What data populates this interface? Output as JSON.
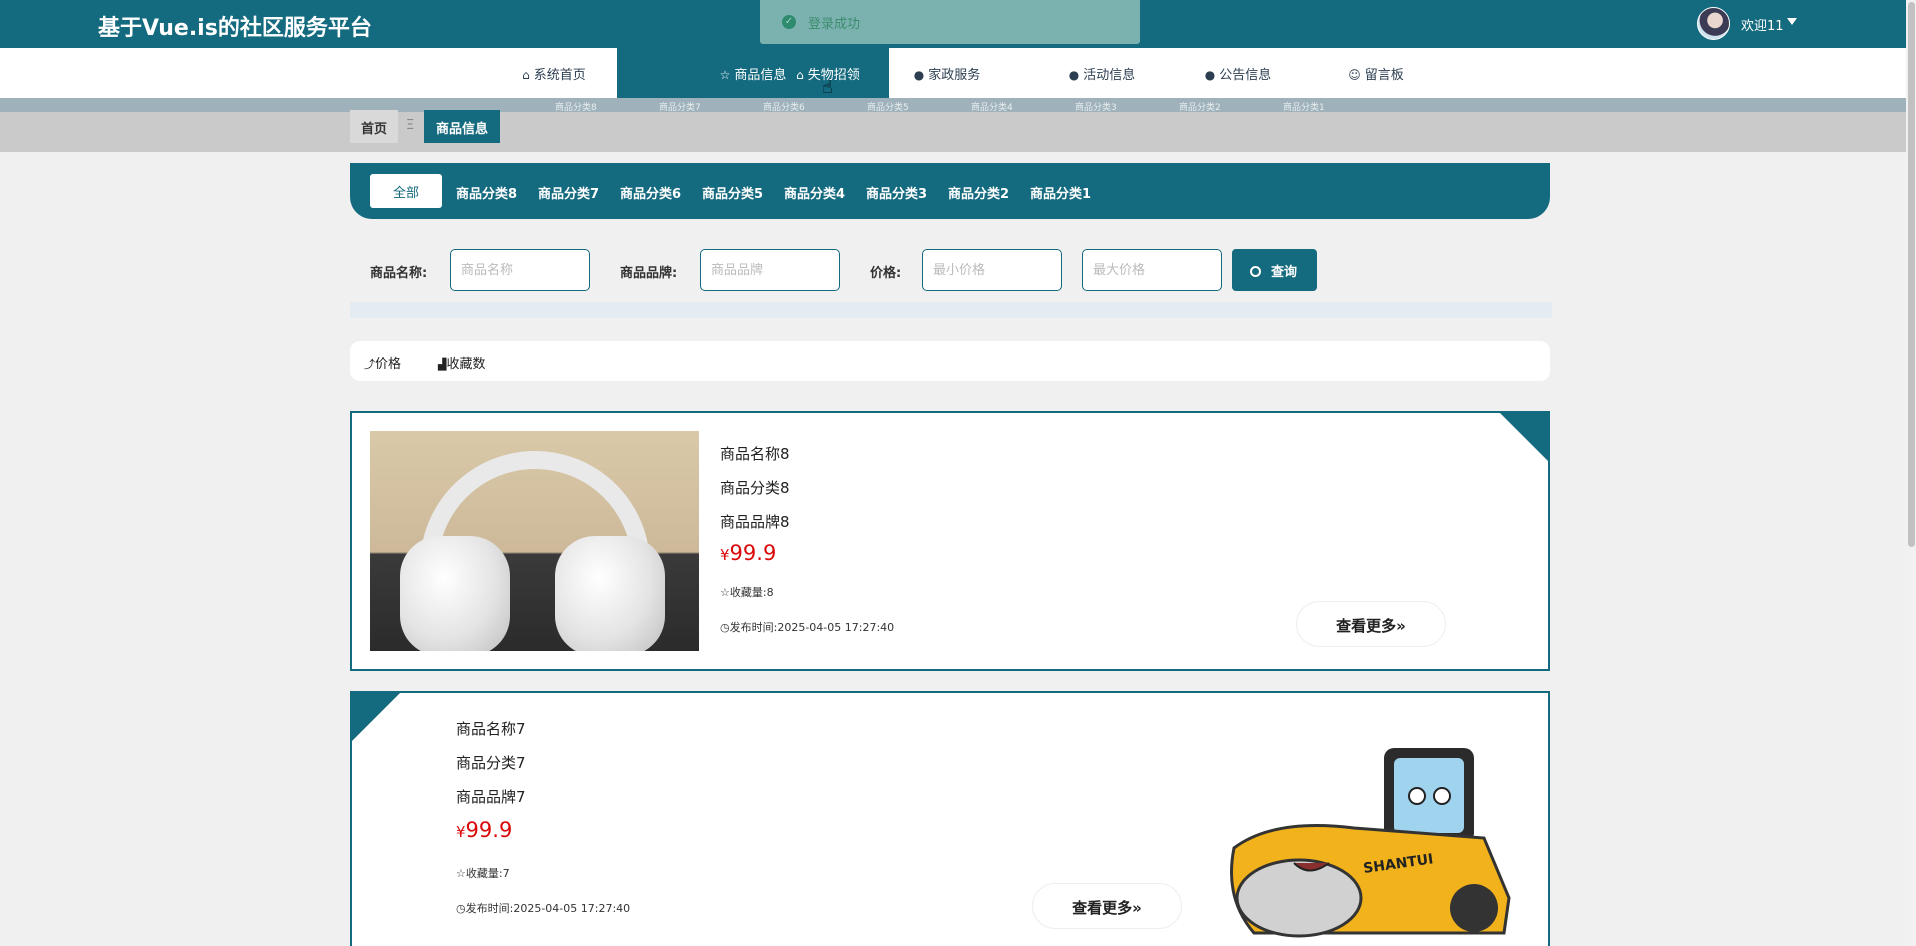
{
  "header": {
    "title": "基于Vue.is的社区服务平台",
    "toast": "登录成功",
    "welcome": "欢迎11"
  },
  "nav": {
    "items": [
      {
        "label": "系统首页",
        "icon": "home-icon"
      },
      {
        "label": "商品信息",
        "icon": "star-icon"
      },
      {
        "label": "失物招领",
        "icon": "bag-icon"
      },
      {
        "label": "家政服务",
        "icon": "info-icon"
      },
      {
        "label": "活动信息",
        "icon": "question-icon"
      },
      {
        "label": "公告信息",
        "icon": "info-icon"
      },
      {
        "label": "留言板",
        "icon": "smile-icon"
      }
    ],
    "active": "商品信息"
  },
  "category_strip": [
    "商品分类8",
    "商品分类7",
    "商品分类6",
    "商品分类5",
    "商品分类4",
    "商品分类3",
    "商品分类2",
    "商品分类1"
  ],
  "breadcrumb": {
    "home": "首页",
    "separator": "Ξ",
    "current": "商品信息"
  },
  "categories": {
    "all": "全部",
    "items": [
      "商品分类8",
      "商品分类7",
      "商品分类6",
      "商品分类5",
      "商品分类4",
      "商品分类3",
      "商品分类2",
      "商品分类1"
    ]
  },
  "filters": {
    "name_label": "商品名称:",
    "name_placeholder": "商品名称",
    "name_value": "",
    "brand_label": "商品品牌:",
    "brand_placeholder": "商品品牌",
    "brand_value": "",
    "price_label": "价格:",
    "min_placeholder": "最小价格",
    "max_placeholder": "最大价格",
    "search_label": "查询"
  },
  "sort": {
    "price": "价格",
    "favorites": "收藏数"
  },
  "products": [
    {
      "name": "商品名称8",
      "category": "商品分类8",
      "brand": "商品品牌8",
      "currency": "¥",
      "price": "99.9",
      "favorites_label": "收藏量:",
      "favorites": "8",
      "time_label": "发布时间:",
      "time": "2025-04-05 17:27:40",
      "more": "查看更多»"
    },
    {
      "name": "商品名称7",
      "category": "商品分类7",
      "brand": "商品品牌7",
      "currency": "¥",
      "price": "99.9",
      "favorites_label": "收藏量:",
      "favorites": "7",
      "time_label": "发布时间:",
      "time": "2025-04-05 17:27:40",
      "more": "查看更多»",
      "image_brand_text": "SHANTUI"
    }
  ],
  "colors": {
    "primary": "#146a7e",
    "price": "#d90a0a",
    "toast_bg": "#7bb2b0"
  }
}
